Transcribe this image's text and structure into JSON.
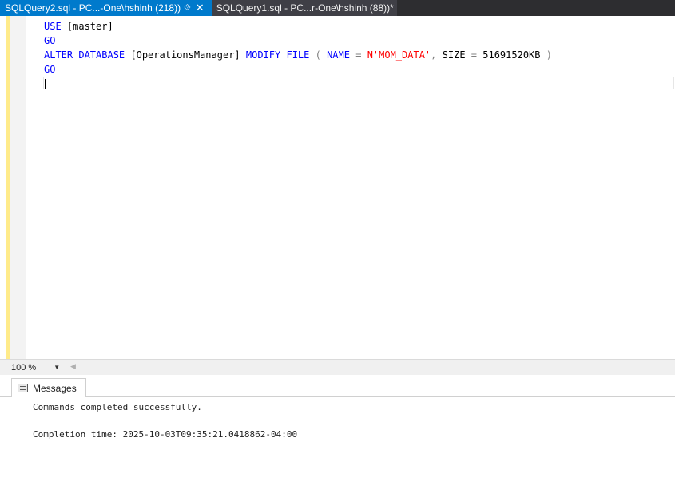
{
  "tabs": [
    {
      "title": "SQLQuery2.sql - PC...-One\\hshinh (218))",
      "pin_icon": "pin-icon",
      "close_icon": "close-icon",
      "active": true
    },
    {
      "title": "SQLQuery1.sql - PC...r-One\\hshinh (88))*",
      "active": false
    }
  ],
  "editor": {
    "lines": [
      {
        "tokens": [
          "USE",
          " [master]"
        ]
      },
      {
        "tokens": [
          "GO"
        ]
      },
      {
        "tokens": [
          "ALTER",
          " ",
          "DATABASE",
          " [OperationsManager] ",
          "MODIFY",
          " ",
          "FILE",
          " ",
          "(",
          " ",
          "NAME",
          " ",
          "=",
          " ",
          "N'MOM_DATA'",
          ",",
          " ",
          "SIZE",
          " ",
          "=",
          " 51691520KB ",
          ")"
        ]
      },
      {
        "tokens": [
          "GO"
        ]
      }
    ]
  },
  "zoom": {
    "value": "100 %",
    "arrow_icon": "chevron-down-icon"
  },
  "results": {
    "tab_label": "Messages",
    "tab_icon": "messages-icon",
    "messages": [
      "Commands completed successfully.",
      "",
      "Completion time: 2025-10-03T09:35:21.0418862-04:00"
    ]
  },
  "colors": {
    "keyword": "#0000ff",
    "operator": "#808080",
    "string": "#ff0000",
    "active_tab": "#007acc",
    "tab_strip": "#2d2d30"
  }
}
